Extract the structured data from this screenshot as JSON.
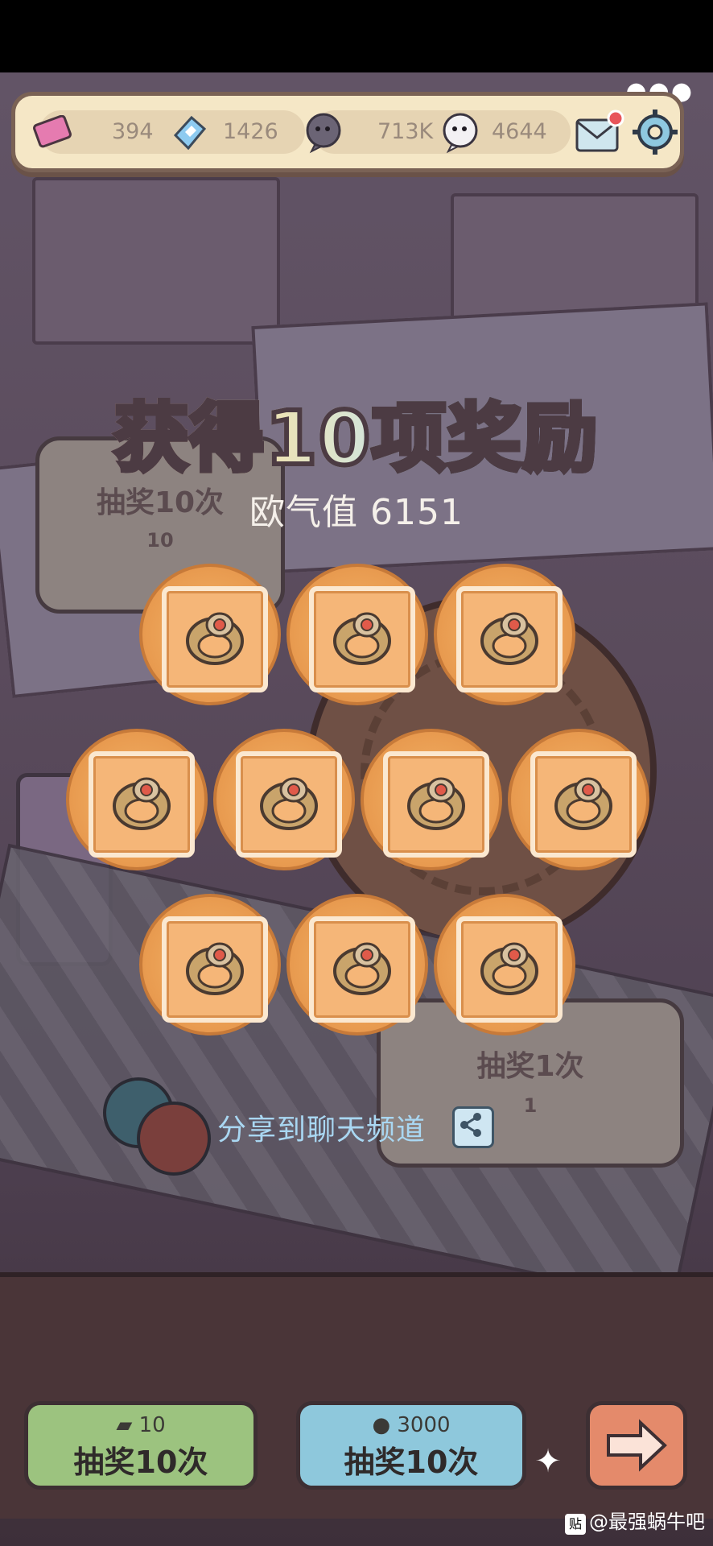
{
  "topbar": {
    "tickets": "394",
    "crystals": "1426",
    "shadow_currency": "713K",
    "spirit_currency": "4644"
  },
  "background": {
    "left_sign_title": "抽奖10次",
    "left_sign_cost": "10",
    "right_sign_title": "抽奖1次",
    "right_sign_cost": "1"
  },
  "result": {
    "title": "获得10项奖励",
    "luck_label": "欧气值 6151"
  },
  "rewards": [
    "ring",
    "ring",
    "ring",
    "ring",
    "ring",
    "ring",
    "ring",
    "ring",
    "ring",
    "ring"
  ],
  "share_label": "分享到聊天频道",
  "buttons": {
    "ticket_draw": {
      "cost": "10",
      "label": "抽奖10次"
    },
    "currency_draw": {
      "cost": "3000",
      "label": "抽奖10次"
    }
  },
  "watermark": "@最强蜗牛吧",
  "watermark_badge": "贴",
  "colors": {
    "accent": "#e89a4f",
    "ticket_button": "#9cc37f",
    "currency_button": "#8ec8dc",
    "next_button": "#e48a6b"
  }
}
